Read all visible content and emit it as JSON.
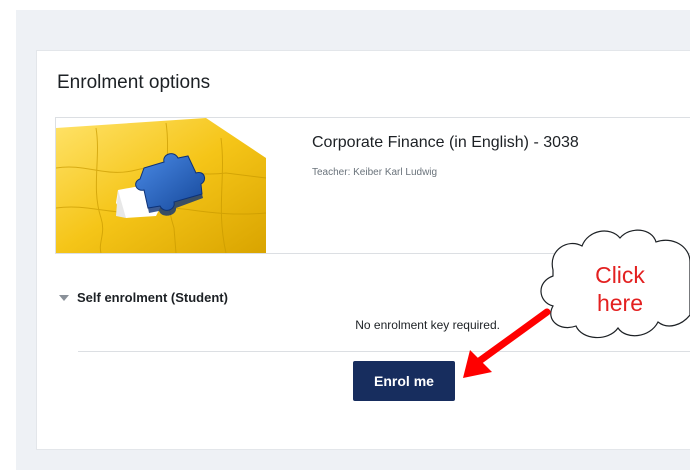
{
  "page": {
    "title": "Enrolment options"
  },
  "course": {
    "name": "Corporate Finance (in English) - 3038",
    "teacher": "Teacher: Keiber Karl Ludwig",
    "image": "puzzle-image"
  },
  "self_enrolment": {
    "section_label": "Self enrolment (Student)",
    "note": "No enrolment key required.",
    "button_label": "Enrol me"
  },
  "annotation": {
    "callout_line1": "Click",
    "callout_line2": "here",
    "callout_color": "#e32020",
    "arrow_color": "#ff0000"
  },
  "colors": {
    "button_bg": "#172d5e",
    "page_bg": "#eef1f5",
    "puzzle_yellow": "#f5c518",
    "puzzle_blue": "#1f5db8"
  }
}
